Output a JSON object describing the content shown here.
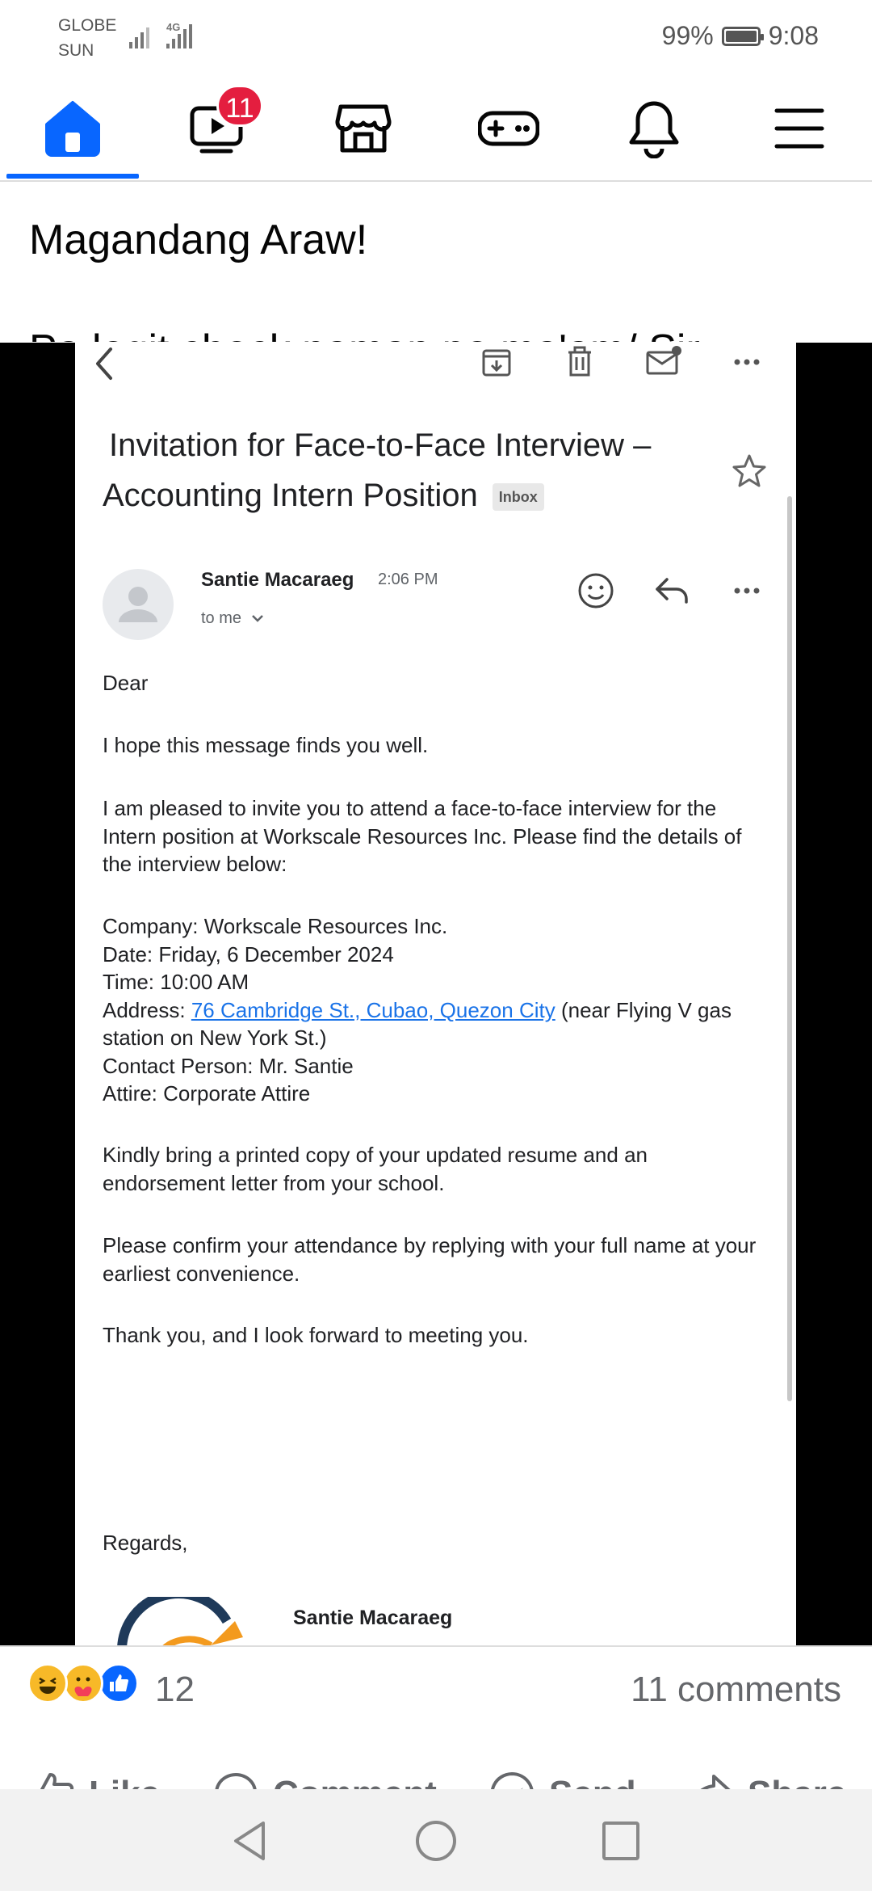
{
  "status_bar": {
    "carrier_1": "GLOBE",
    "carrier_2": "SUN",
    "network": "4G",
    "battery_percent": "99%",
    "time": "9:08"
  },
  "nav": {
    "items": [
      "home-icon",
      "video-icon",
      "marketplace-icon",
      "gaming-icon",
      "notifications-icon",
      "menu-icon"
    ],
    "active": "home",
    "video_badge": "11",
    "accent_color": "#0866ff",
    "badge_color": "#e41e3f"
  },
  "post": {
    "partial_line": "Magandang Araw!",
    "text": "Pa legit check naman po ma'am/ Sir\nsalamat"
  },
  "email": {
    "subject_line1": "Invitation for Face-to-Face Interview –",
    "subject_line2": "Accounting Intern Position",
    "label": "Inbox",
    "sender": "Santie Macaraeg",
    "time": "2:06 PM",
    "recipient": "to me",
    "greeting": "Dear",
    "p1": "I hope this message finds you well.",
    "p2": "I am pleased to invite you to attend a face-to-face interview for the Intern position at Workscale Resources Inc. Please find the details of the interview below:",
    "company": "Company: Workscale Resources Inc.",
    "date": "Date: Friday, 6 December 2024",
    "time_line": "Time: 10:00 AM",
    "address_label": "Address: ",
    "address_link": "76 Cambridge St., Cubao, Quezon City",
    "address_rest": " (near Flying V gas station on New York St.)",
    "contact": "Contact Person: Mr. Santie",
    "attire": "Attire: Corporate Attire",
    "p3": "Kindly bring a printed copy of your updated resume and an endorsement letter from your school.",
    "p4": "Please confirm your attendance by replying with your full name at your earliest convenience.",
    "p5": "Thank you, and I look forward to meeting you.",
    "regards": "Regards,",
    "signature_name": "Santie Macaraeg"
  },
  "reactions": {
    "emojis": [
      "laughing",
      "care",
      "like"
    ],
    "count": "12",
    "comments": "11 comments"
  },
  "actions": {
    "like": "Like",
    "comment": "Comment",
    "send": "Send",
    "share": "Share"
  }
}
